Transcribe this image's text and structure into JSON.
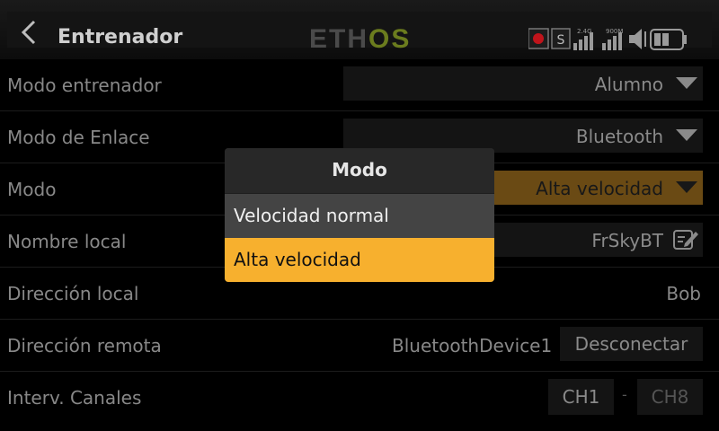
{
  "header": {
    "title": "Entrenador",
    "logo_part1": "ETH",
    "logo_part2": "OS",
    "status": {
      "s_label": "S",
      "rx_label": "2.4G",
      "tx_label": "900M"
    }
  },
  "rows": [
    {
      "label": "Modo entrenador",
      "value": "Alumno"
    },
    {
      "label": "Modo de Enlace",
      "value": "Bluetooth"
    },
    {
      "label": "Modo",
      "value": "Alta velocidad"
    },
    {
      "label": "Nombre local",
      "value": "FrSkyBT"
    },
    {
      "label": "Dirección local",
      "value": "Bob"
    },
    {
      "label": "Dirección remota",
      "value": "BluetoothDevice1",
      "button": "Desconectar"
    },
    {
      "label": "Interv. Canales",
      "ch_start": "CH1",
      "dash": "-",
      "ch_end": "CH8"
    }
  ],
  "modal": {
    "title": "Modo",
    "options": [
      "Velocidad normal",
      "Alta velocidad"
    ],
    "selected": "Alta velocidad"
  },
  "colors": {
    "accent": "#f7b02e",
    "accent_dim": "#6a4a14",
    "logo_green": "#6b7c1e"
  }
}
